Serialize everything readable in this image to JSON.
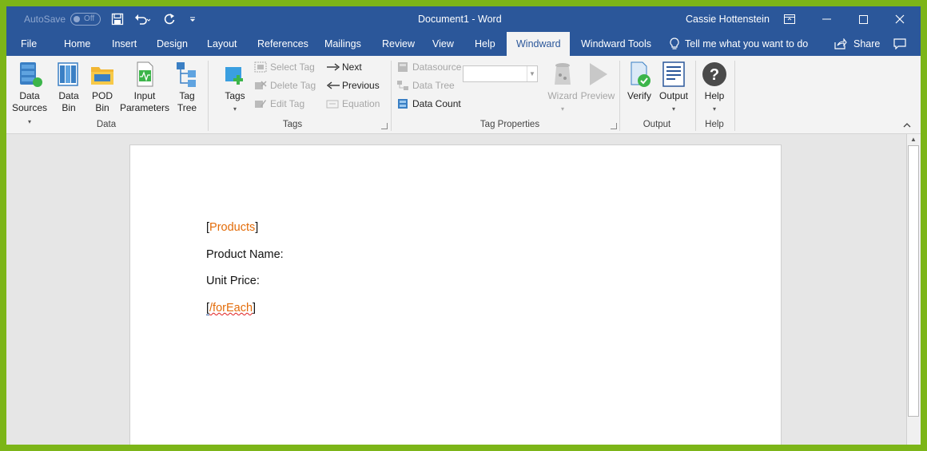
{
  "titlebar": {
    "autosave_label": "AutoSave",
    "autosave_state": "Off",
    "title": "Document1  -  Word",
    "user": "Cassie Hottenstein"
  },
  "menu": {
    "tabs": [
      "File",
      "Home",
      "Insert",
      "Design",
      "Layout",
      "References",
      "Mailings",
      "Review",
      "View",
      "Help",
      "Windward",
      "Windward Tools"
    ],
    "active_tab": "Windward",
    "tell_me": "Tell me what you want to do",
    "share": "Share"
  },
  "ribbon": {
    "data_group": {
      "label": "Data",
      "data_sources": [
        "Data",
        "Sources"
      ],
      "data_bin": [
        "Data",
        "Bin"
      ],
      "pod_bin": [
        "POD",
        "Bin"
      ],
      "input_parameters": [
        "Input",
        "Parameters"
      ],
      "tag_tree": [
        "Tag",
        "Tree"
      ]
    },
    "tags_group": {
      "label": "Tags",
      "tags": "Tags",
      "select_tag": "Select Tag",
      "delete_tag": "Delete Tag",
      "edit_tag": "Edit Tag",
      "next": "Next",
      "previous": "Previous",
      "equation": "Equation"
    },
    "tag_properties_group": {
      "label": "Tag Properties",
      "datasource": "Datasource",
      "data_tree": "Data Tree",
      "data_count": "Data Count",
      "wizard": "Wizard",
      "preview": "Preview"
    },
    "output_group": {
      "label": "Output",
      "verify": "Verify",
      "output": "Output"
    },
    "help_group": {
      "label": "Help",
      "help": "Help"
    }
  },
  "document": {
    "line1_open": "[",
    "line1_tag": "Products",
    "line1_close": "]",
    "line2": "Product Name:",
    "line3": "Unit Price:",
    "line4_open": "[",
    "line4_tag": "/forEach",
    "line4_close": "]"
  },
  "colors": {
    "word_blue": "#2b579a",
    "tag_orange": "#e36c09",
    "frame_green": "#7cb518"
  }
}
